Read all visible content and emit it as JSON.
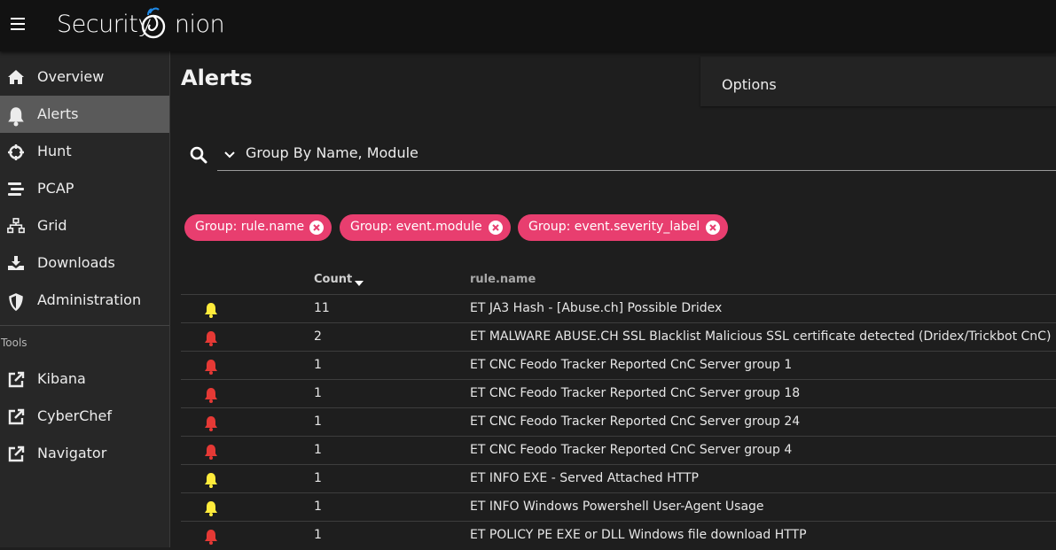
{
  "app": {
    "brand": "Security",
    "brand_suffix": "nion"
  },
  "sidebar": {
    "items": [
      {
        "label": "Overview",
        "icon": "home-icon"
      },
      {
        "label": "Alerts",
        "icon": "bell-icon",
        "active": true
      },
      {
        "label": "Hunt",
        "icon": "crosshairs-icon"
      },
      {
        "label": "PCAP",
        "icon": "stream-icon"
      },
      {
        "label": "Grid",
        "icon": "sitemap-icon"
      },
      {
        "label": "Downloads",
        "icon": "download-icon"
      },
      {
        "label": "Administration",
        "icon": "shield-icon"
      }
    ],
    "tools_label": "Tools",
    "tools": [
      {
        "label": "Kibana",
        "icon": "external-link-icon"
      },
      {
        "label": "CyberChef",
        "icon": "external-link-icon"
      },
      {
        "label": "Navigator",
        "icon": "external-link-icon"
      }
    ]
  },
  "main": {
    "title": "Alerts",
    "options_label": "Options",
    "query": "Group By Name, Module",
    "chips": [
      {
        "label": "Group: rule.name"
      },
      {
        "label": "Group: event.module"
      },
      {
        "label": "Group: event.severity_label"
      }
    ],
    "table": {
      "columns": [
        "Count",
        "rule.name"
      ],
      "rows": [
        {
          "severity": "medium",
          "count": "11",
          "name": "ET JA3 Hash - [Abuse.ch] Possible Dridex"
        },
        {
          "severity": "high",
          "count": "2",
          "name": "ET MALWARE ABUSE.CH SSL Blacklist Malicious SSL certificate detected (Dridex/Trickbot CnC)"
        },
        {
          "severity": "high",
          "count": "1",
          "name": "ET CNC Feodo Tracker Reported CnC Server group 1"
        },
        {
          "severity": "high",
          "count": "1",
          "name": "ET CNC Feodo Tracker Reported CnC Server group 18"
        },
        {
          "severity": "high",
          "count": "1",
          "name": "ET CNC Feodo Tracker Reported CnC Server group 24"
        },
        {
          "severity": "high",
          "count": "1",
          "name": "ET CNC Feodo Tracker Reported CnC Server group 4"
        },
        {
          "severity": "medium",
          "count": "1",
          "name": "ET INFO EXE - Served Attached HTTP"
        },
        {
          "severity": "medium",
          "count": "1",
          "name": "ET INFO Windows Powershell User-Agent Usage"
        },
        {
          "severity": "high",
          "count": "1",
          "name": "ET POLICY PE EXE or DLL Windows file download HTTP"
        }
      ]
    }
  },
  "colors": {
    "chip": "#e83e6f",
    "severity_high": "#e53935",
    "severity_medium": "#ffeb3b",
    "active_nav": "#5a5a5a"
  }
}
